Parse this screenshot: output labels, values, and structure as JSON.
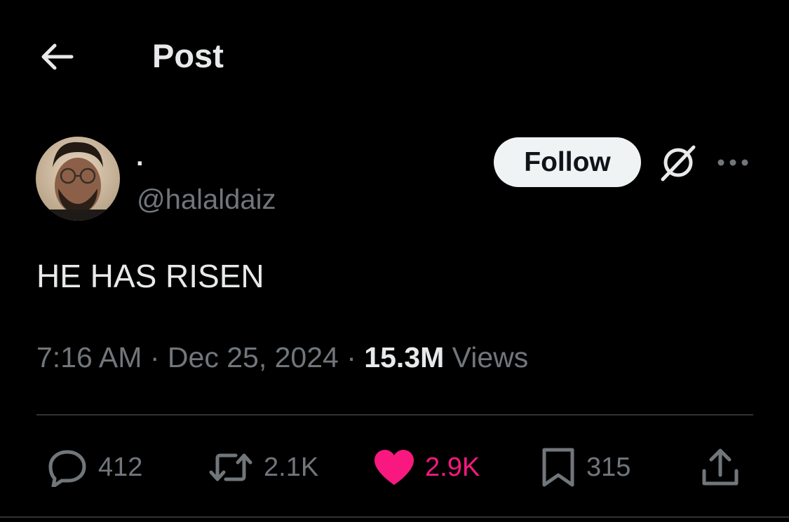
{
  "header": {
    "title": "Post",
    "back_icon": "arrow-left-icon"
  },
  "author": {
    "display_name": "·",
    "handle": "@halaldaiz",
    "avatar": "avatar-photo"
  },
  "actions_top": {
    "follow_label": "Follow",
    "grok_icon": "grok-icon",
    "more_icon": "more-horizontal-icon"
  },
  "tweet": {
    "text": "HE HAS RISEN",
    "time": "7:16 AM",
    "date": "Dec 25, 2024",
    "views_count": "15.3M",
    "views_label": "Views",
    "separator": "·"
  },
  "engagement": {
    "replies": "412",
    "reposts": "2.1K",
    "likes": "2.9K",
    "bookmarks": "315",
    "liked": true
  },
  "colors": {
    "background": "#000000",
    "text_primary": "#e7e9ea",
    "text_secondary": "#71767b",
    "like_pink": "#f91880",
    "follow_bg": "#eff3f4",
    "divider": "#2f3336"
  }
}
